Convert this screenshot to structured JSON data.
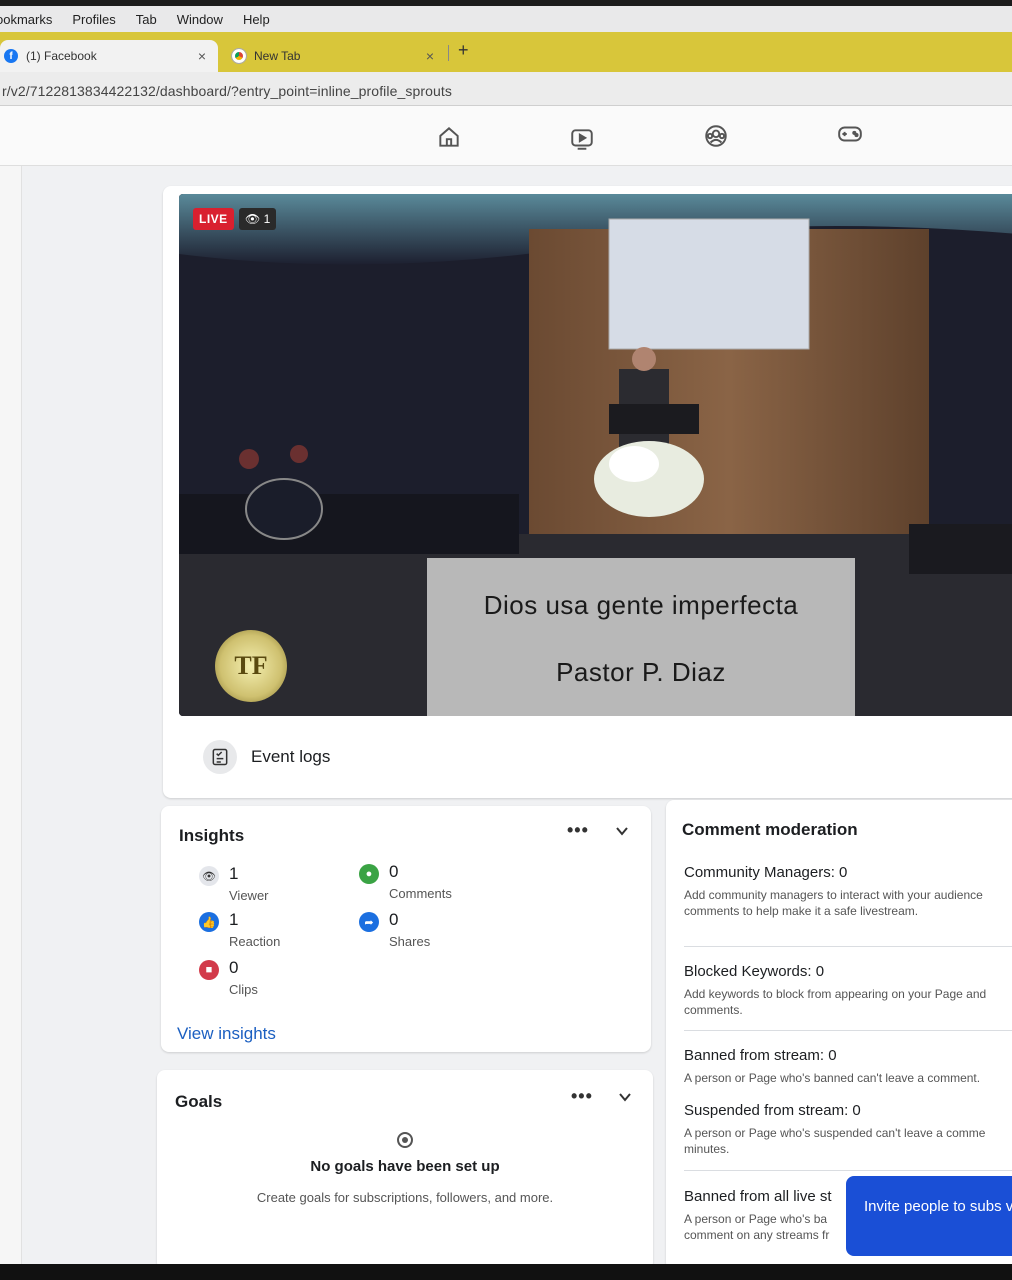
{
  "menubar": {
    "items": [
      "ookmarks",
      "Profiles",
      "Tab",
      "Window",
      "Help"
    ]
  },
  "tabs": [
    {
      "title": "(1) Facebook",
      "icon": "facebook-icon"
    },
    {
      "title": "New Tab",
      "icon": "chrome-icon"
    }
  ],
  "new_tab_symbol": "+",
  "close_symbol": "×",
  "address": {
    "url": "r/v2/7122813834422132/dashboard/?entry_point=inline_profile_sprouts"
  },
  "video": {
    "live_label": "LIVE",
    "viewer_count": "1",
    "lower_third_title": "Dios usa gente imperfecta",
    "lower_third_subtitle": "Pastor P. Diaz",
    "logo_letters": "TF"
  },
  "event_logs": {
    "label": "Event logs"
  },
  "insights": {
    "title": "Insights",
    "viewer": {
      "value": "1",
      "label": "Viewer"
    },
    "comments": {
      "value": "0",
      "label": "Comments"
    },
    "reaction": {
      "value": "1",
      "label": "Reaction"
    },
    "shares": {
      "value": "0",
      "label": "Shares"
    },
    "clips": {
      "value": "0",
      "label": "Clips"
    },
    "link": "View insights"
  },
  "goals": {
    "title": "Goals",
    "empty_title": "No goals have been set up",
    "empty_subtitle": "Create goals for subscriptions, followers, and more."
  },
  "moderation": {
    "title": "Comment moderation",
    "community": {
      "heading": "Community Managers: 0",
      "desc": "Add community managers to interact with your audience comments to help make it a safe livestream."
    },
    "keywords": {
      "heading": "Blocked Keywords: 0",
      "desc": "Add keywords to block from appearing on your Page and comments."
    },
    "banned": {
      "heading": "Banned from stream: 0",
      "desc": "A person or Page who's banned can't leave a comment."
    },
    "suspended": {
      "heading": "Suspended from stream: 0",
      "desc": "A person or Page who's suspended can't leave a comme minutes."
    },
    "banned_all": {
      "heading": "Banned from all live st",
      "desc": "A person or Page who's ba comment on any streams fr"
    }
  },
  "tooltip": {
    "text": "Invite people to subs videos"
  },
  "colors": {
    "live": "#d9202f",
    "link": "#1b5fc1",
    "tooltip": "#1a4fd6",
    "tab_strip": "#d8c63a"
  }
}
